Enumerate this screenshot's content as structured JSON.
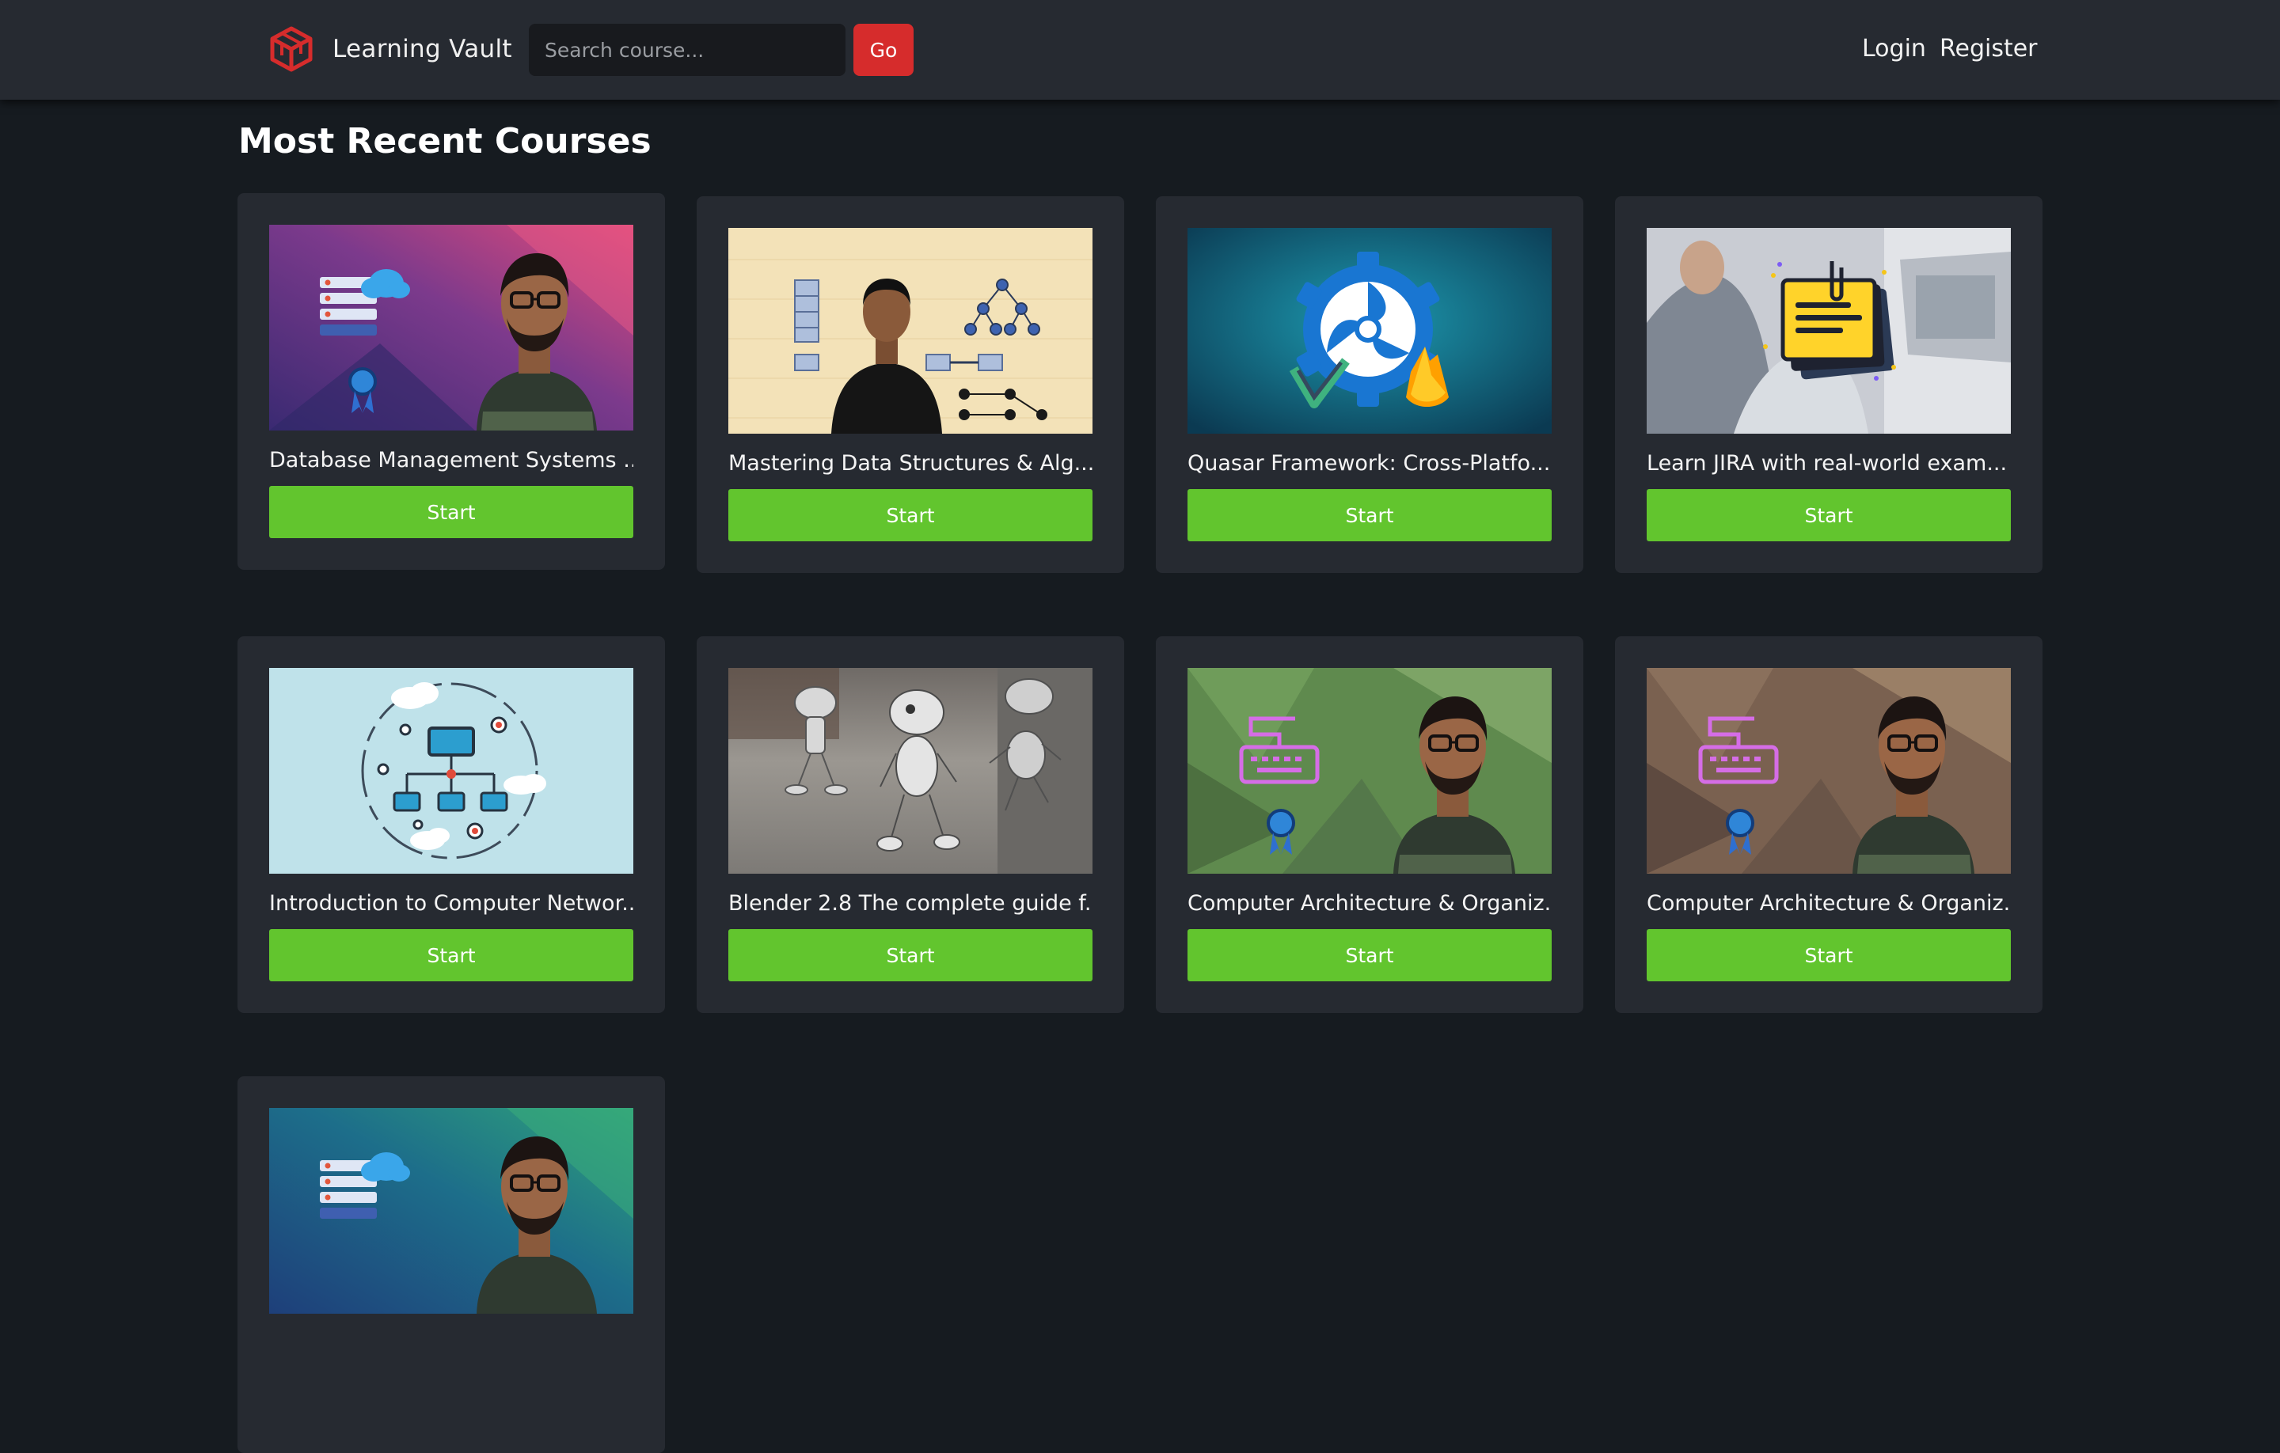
{
  "header": {
    "brand": "Learning Vault",
    "search_placeholder": "Search course...",
    "go_label": "Go",
    "login_label": "Login",
    "register_label": "Register",
    "logo_icon": "cube-logo-icon",
    "accent_color": "#d62c2c"
  },
  "main": {
    "title": "Most Recent Courses",
    "start_color": "#62c52e",
    "courses": [
      {
        "title": "Database Management Systems ...",
        "start_label": "Start",
        "thumbnail": "instructor-database-thumbnail"
      },
      {
        "title": "Mastering Data Structures & Alg...",
        "start_label": "Start",
        "thumbnail": "instructor-data-structures-thumbnail"
      },
      {
        "title": "Quasar Framework: Cross-Platfo...",
        "start_label": "Start",
        "thumbnail": "quasar-logo-thumbnail"
      },
      {
        "title": "Learn JIRA with real-world exam...",
        "start_label": "Start",
        "thumbnail": "office-notes-thumbnail"
      },
      {
        "title": "Introduction to Computer Networ...",
        "start_label": "Start",
        "thumbnail": "network-diagram-thumbnail"
      },
      {
        "title": "Blender 2.8 The complete guide f...",
        "start_label": "Start",
        "thumbnail": "robots-3d-thumbnail"
      },
      {
        "title": "Computer Architecture & Organiz...",
        "start_label": "Start",
        "thumbnail": "instructor-keyboard-green-thumbnail"
      },
      {
        "title": "Computer Architecture & Organiz...",
        "start_label": "Start",
        "thumbnail": "instructor-keyboard-brown-thumbnail"
      },
      {
        "title": "",
        "start_label": "",
        "thumbnail": "instructor-database-teal-thumbnail"
      }
    ]
  }
}
